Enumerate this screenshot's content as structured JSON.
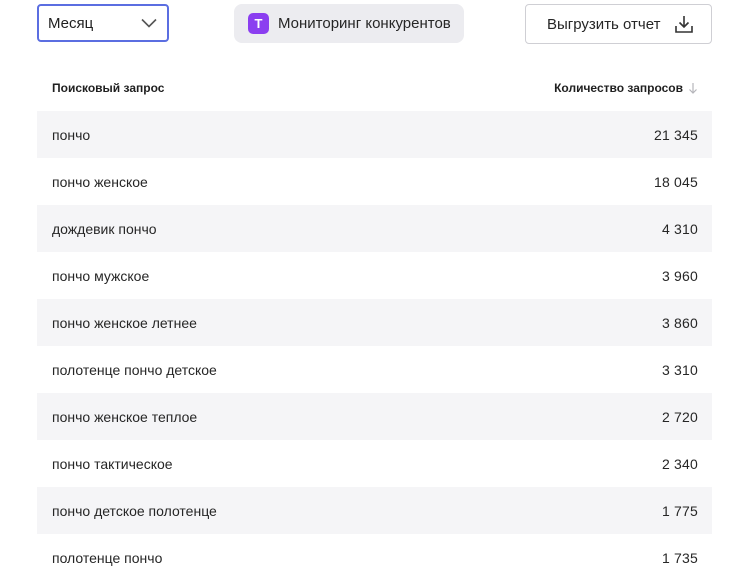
{
  "toolbar": {
    "period_select": {
      "value": "Месяц"
    },
    "monitoring_button": {
      "badge": "T",
      "label": "Мониторинг конкурентов"
    },
    "export_button": {
      "label": "Выгрузить отчет"
    }
  },
  "table": {
    "columns": {
      "query": "Поисковый запрос",
      "count": "Количество запросов"
    },
    "rows": [
      {
        "query": "пончо",
        "count": "21 345"
      },
      {
        "query": "пончо женское",
        "count": "18 045"
      },
      {
        "query": "дождевик пончо",
        "count": "4 310"
      },
      {
        "query": "пончо мужское",
        "count": "3 960"
      },
      {
        "query": "пончо женское летнее",
        "count": "3 860"
      },
      {
        "query": "полотенце пончо детское",
        "count": "3 310"
      },
      {
        "query": "пончо женское теплое",
        "count": "2 720"
      },
      {
        "query": "пончо тактическое",
        "count": "2 340"
      },
      {
        "query": "пончо детское полотенце",
        "count": "1 775"
      },
      {
        "query": "полотенце пончо",
        "count": "1 735"
      }
    ]
  },
  "colors": {
    "select_border": "#5b6ee1",
    "badge": "#8b3ef0",
    "row_stripe": "#f5f5f7"
  },
  "icons": {
    "select": "chevron-down-icon",
    "export": "download-icon",
    "sort": "sort-down-arrow-icon"
  }
}
